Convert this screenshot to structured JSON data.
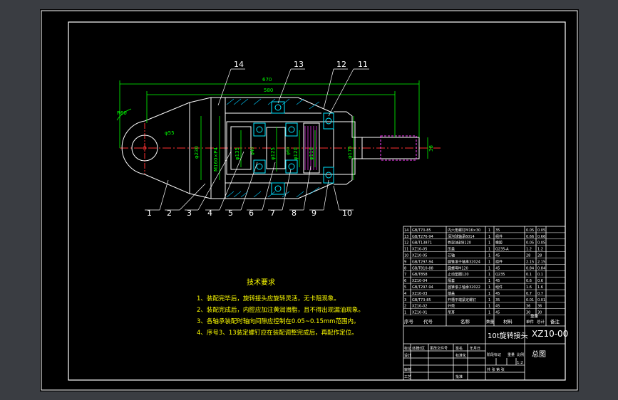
{
  "colors": {
    "sheet": "#000000",
    "outline": "#ffffff",
    "dimension": "#00ff00",
    "centerline": "#ff3030",
    "hidden": "#ff40ff",
    "bearing": "#00e5ff",
    "leader": "#ffffff",
    "notes": "#ffff00",
    "part_mark": "#ffff00",
    "section_hatch": "#00ccff"
  },
  "balloons": [
    "1",
    "2",
    "3",
    "4",
    "5",
    "6",
    "7",
    "8",
    "9",
    "10",
    "11",
    "12",
    "13",
    "14"
  ],
  "dimensions": {
    "overall_length": "670",
    "inner_length": "580",
    "radius": "R60",
    "pin_hole": "φ55",
    "body_dia": "φ230",
    "thread": "M160×P4",
    "dia_a": "φ135",
    "dia_b": "φ125",
    "dia_c": "φ120",
    "dia_d": "φ110",
    "dia_e": "φ175",
    "shaft_end": "38",
    "small_a": "φ40",
    "small_b": "φ60"
  },
  "tech_requirements": {
    "title": "技术要求",
    "items": [
      "1、装配完毕后，旋转接头应旋转灵活，无卡阻现象。",
      "2、装配完成后，内腔应加注黄润滑脂，且不得出现漏油现象。",
      "3、各轴承装配时轴向间隙应控制在0.05~0.15mm范围内。",
      "4、序号3、13装定螺钉应在装配调整完成后，再配作定位。"
    ]
  },
  "parts_list": {
    "rows": [
      {
        "no": "14",
        "code": "GB/T70-85",
        "name": "内六角螺钉M16×30",
        "qty": "1",
        "mat": "35",
        "w": "0.05",
        "tw": "0.05"
      },
      {
        "no": "13",
        "code": "GB/T276-94",
        "name": "深沟球轴承6014",
        "qty": "1",
        "mat": "组件",
        "w": "0.66",
        "tw": "0.66"
      },
      {
        "no": "12",
        "code": "GB/T13871",
        "name": "骨架油封B120",
        "qty": "1",
        "mat": "橡胶",
        "w": "0.05",
        "tw": "0.05"
      },
      {
        "no": "11",
        "code": "XZ10-05",
        "name": "压盖",
        "qty": "1",
        "mat": "Q235-A",
        "w": "1.2",
        "tw": "1.2"
      },
      {
        "no": "10",
        "code": "XZ10-05",
        "name": "芯轴",
        "qty": "1",
        "mat": "45",
        "w": "28",
        "tw": "28"
      },
      {
        "no": "9",
        "code": "GB/T297-94",
        "name": "圆锥滚子轴承32024",
        "qty": "1",
        "mat": "组件",
        "w": "2.15",
        "tw": "2.15"
      },
      {
        "no": "8",
        "code": "GB/T810-88",
        "name": "圆螺母M120",
        "qty": "1",
        "mat": "45",
        "w": "0.84",
        "tw": "0.84"
      },
      {
        "no": "7",
        "code": "GB/T858",
        "name": "止动垫圈120",
        "qty": "1",
        "mat": "Q235",
        "w": "0.1",
        "tw": "0.1"
      },
      {
        "no": "6",
        "code": "XZ10-04",
        "name": "隔套",
        "qty": "1",
        "mat": "45",
        "w": "0.6",
        "tw": "0.6"
      },
      {
        "no": "5",
        "code": "GB/T297-94",
        "name": "圆锥滚子轴承32022",
        "qty": "1",
        "mat": "组件",
        "w": "1.6",
        "tw": "1.6"
      },
      {
        "no": "4",
        "code": "XZ10-03",
        "name": "端盖",
        "qty": "1",
        "mat": "45",
        "w": "0.7",
        "tw": "0.7"
      },
      {
        "no": "3",
        "code": "GB/T73-85",
        "name": "开槽平端紧定螺钉",
        "qty": "1",
        "mat": "35",
        "w": "0.01",
        "tw": "0.01"
      },
      {
        "no": "2",
        "code": "XZ10-02",
        "name": "外壳",
        "qty": "1",
        "mat": "45",
        "w": "36",
        "tw": "36"
      },
      {
        "no": "1",
        "code": "XZ10-01",
        "name": "吊耳",
        "qty": "1",
        "mat": "45",
        "w": "30",
        "tw": "30"
      }
    ],
    "header": {
      "no": "序号",
      "code": "代号",
      "name": "名称",
      "qty": "数量",
      "mat": "材料",
      "w": "单件",
      "tw": "总计",
      "note": "备注",
      "mass": "重量"
    }
  },
  "title_block": {
    "product": "10t旋转接头",
    "drawing_no": "XZ10-00",
    "drawing_name": "总图",
    "labels": {
      "mark": "标记",
      "count": "处数",
      "zone": "分区",
      "change": "更改文件号",
      "sign": "签名",
      "date": "年月日",
      "design": "设计",
      "std": "标准化",
      "stage": "阶段标记",
      "weight": "重量",
      "scale": "比例",
      "review": "审核",
      "process": "工艺",
      "approve": "批准",
      "sheets": "共 张 第 张",
      "scale_val": "1:2"
    }
  }
}
